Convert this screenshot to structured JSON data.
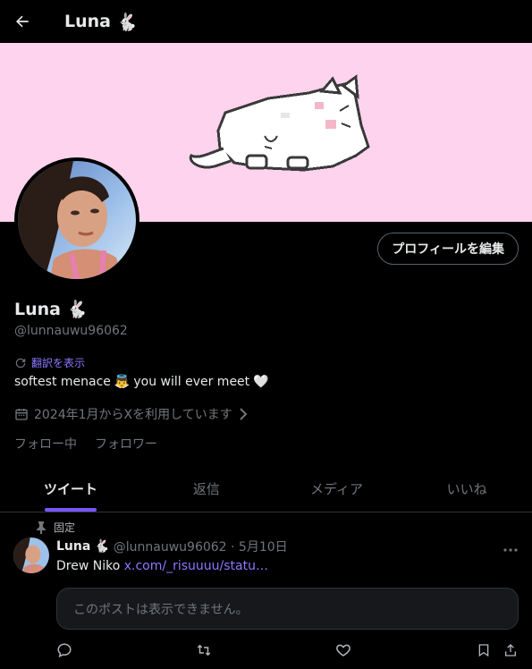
{
  "header": {
    "title": "Luna",
    "title_emoji": "🐇"
  },
  "profile": {
    "edit_button": "プロフィールを編集",
    "name": "Luna",
    "name_emoji": "🐇",
    "handle": "@lunnauwu96062",
    "translate_label": "翻訳を表示",
    "bio_text_1": "softest menace",
    "bio_emoji_1": "👼",
    "bio_text_2": "you will ever meet",
    "bio_emoji_2": "🤍",
    "joined": "2024年1月からXを利用しています",
    "following_label": "フォロー中",
    "followers_label": "フォロワー"
  },
  "tabs": [
    {
      "label": "ツイート",
      "active": true
    },
    {
      "label": "返信",
      "active": false
    },
    {
      "label": "メディア",
      "active": false
    },
    {
      "label": "いいね",
      "active": false
    }
  ],
  "tweet": {
    "pinned_label": "固定",
    "author_name": "Luna",
    "author_emoji": "🐇",
    "meta": "@lunnauwu96062 · 5月10日",
    "text": "Drew Niko",
    "link": "x.com/_risuuuu/statu…",
    "unavailable": "このポストは表示できません。"
  },
  "colors": {
    "accent": "#7856ff",
    "link": "#8b78ff",
    "banner_bg": "#fdd3ed",
    "muted": "#71767b",
    "text": "#e7e9ea"
  }
}
